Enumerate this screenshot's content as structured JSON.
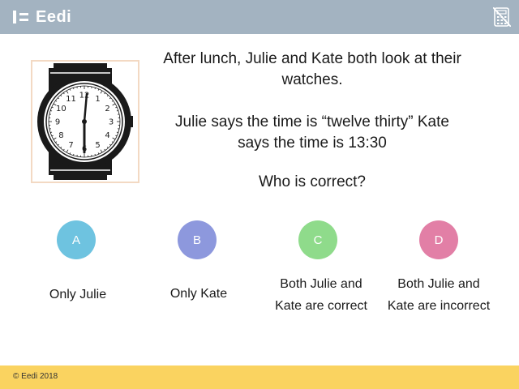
{
  "header": {
    "brand_name": "Eedi",
    "background": "#a3b3c1",
    "icon": "calculator-crossed-icon"
  },
  "question": {
    "line1": "After lunch, Julie and Kate both look at their watches.",
    "line2": "Julie says the time is “twelve thirty” Kate says the time is 13:30",
    "line3": "Who is correct?"
  },
  "watch": {
    "icon": "analog-watch",
    "numerals": [
      "12",
      "1",
      "2",
      "3",
      "4",
      "5",
      "6",
      "7",
      "8",
      "9",
      "10",
      "11"
    ],
    "time_shown": "12:30"
  },
  "options": [
    {
      "letter": "A",
      "text": "Only Julie",
      "color": "#6ec3e0"
    },
    {
      "letter": "B",
      "text": "Only Kate",
      "color": "#8d98dd"
    },
    {
      "letter": "C",
      "text": "Both Julie and Kate are correct",
      "color": "#8fdb8b"
    },
    {
      "letter": "D",
      "text": "Both Julie and Kate are incorrect",
      "color": "#e27fa6"
    }
  ],
  "footer": {
    "copyright": "© Eedi 2018",
    "background": "#fad360"
  }
}
